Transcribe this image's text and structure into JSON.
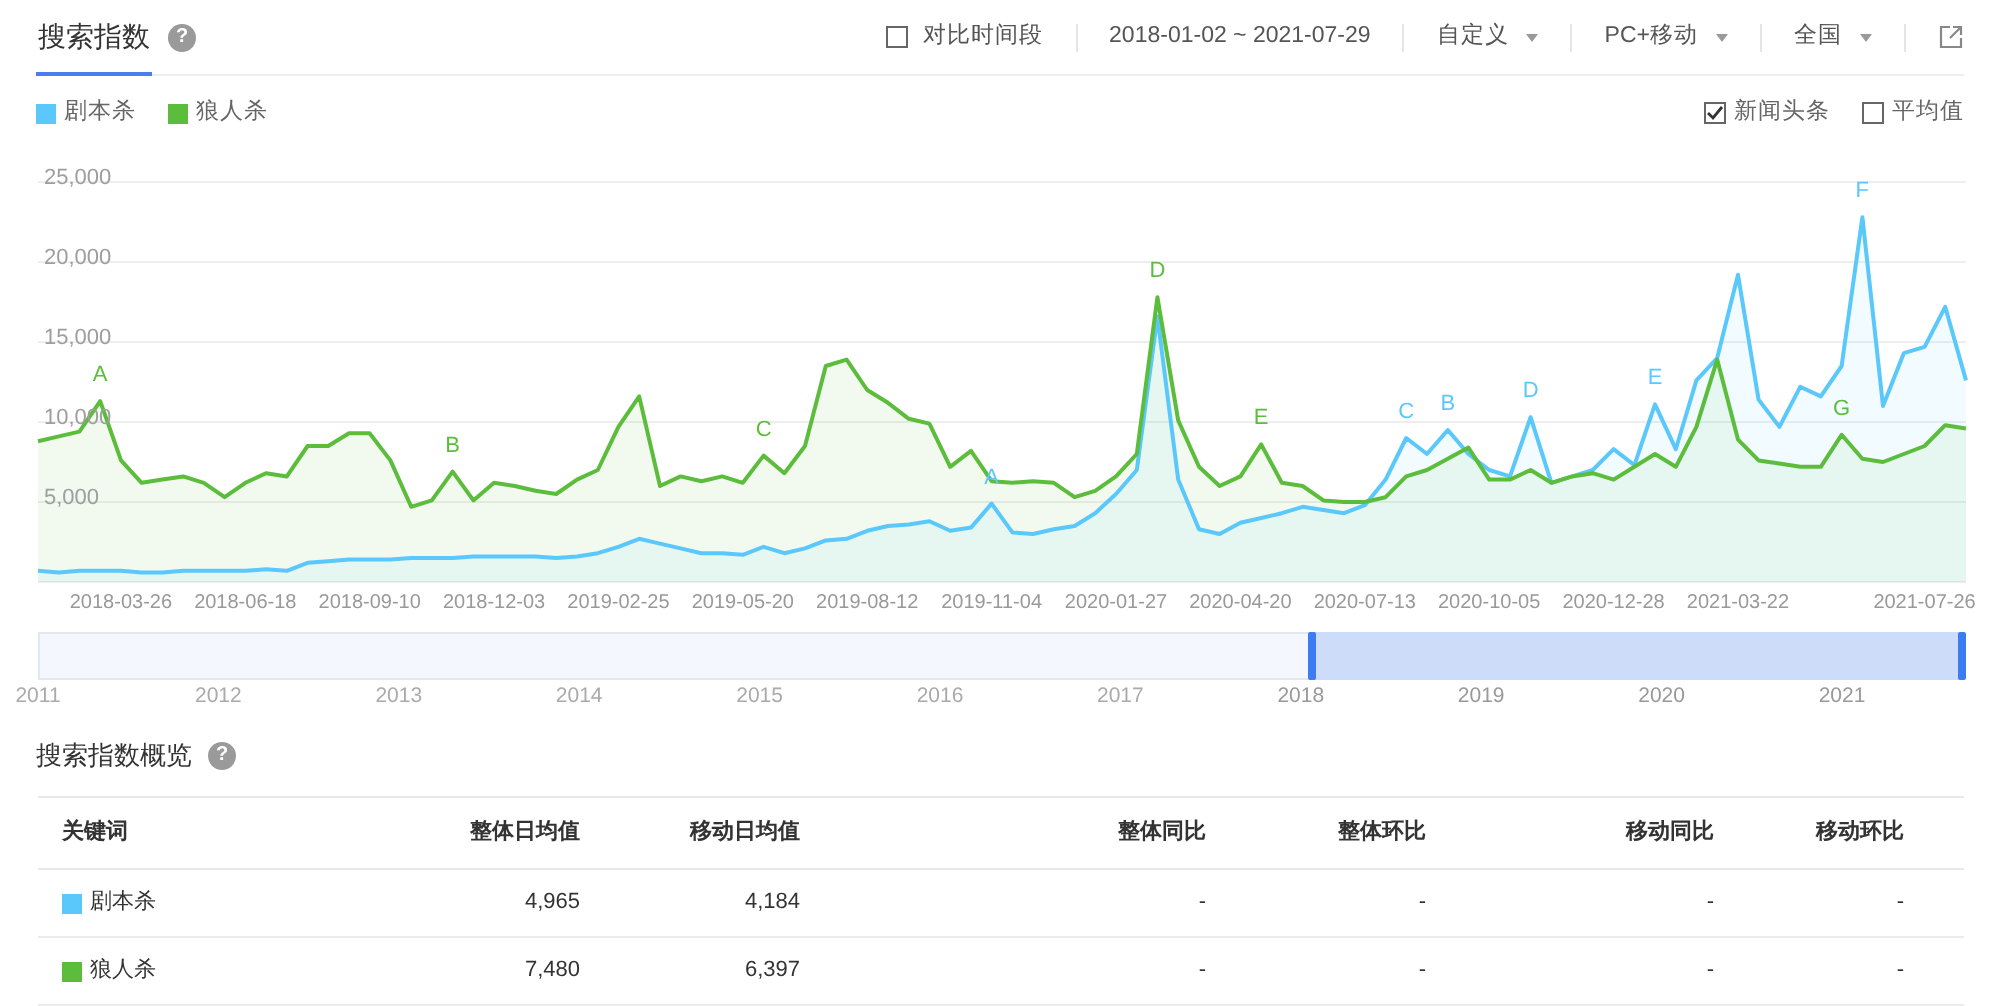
{
  "tabs": [
    {
      "label": "搜索指数",
      "selected": true
    }
  ],
  "help": "?",
  "compare": {
    "label": "对比时间段",
    "checked": false
  },
  "date_range": "2018-01-02 ~ 2021-07-29",
  "dropdowns": [
    {
      "label": "自定义"
    },
    {
      "label": "PC+移动"
    },
    {
      "label": "全国"
    }
  ],
  "options": [
    {
      "label": "新闻头条",
      "checked": true
    },
    {
      "label": "平均值",
      "checked": false
    }
  ],
  "chart_data": {
    "type": "area",
    "grid": true,
    "ylim": [
      0,
      25000
    ],
    "categories": [
      null,
      null,
      null,
      null,
      "2018-03-26",
      null,
      null,
      null,
      null,
      null,
      "2018-06-18",
      null,
      null,
      null,
      null,
      null,
      "2018-09-10",
      null,
      null,
      null,
      null,
      null,
      "2018-12-03",
      null,
      null,
      null,
      null,
      null,
      "2019-02-25",
      null,
      null,
      null,
      null,
      null,
      "2019-05-20",
      null,
      null,
      null,
      null,
      null,
      "2019-08-12",
      null,
      null,
      null,
      null,
      null,
      "2019-11-04",
      null,
      null,
      null,
      null,
      null,
      "2020-01-27",
      null,
      null,
      null,
      null,
      null,
      "2020-04-20",
      null,
      null,
      null,
      null,
      null,
      "2020-07-13",
      null,
      null,
      null,
      null,
      null,
      "2020-10-05",
      null,
      null,
      null,
      null,
      null,
      "2020-12-28",
      null,
      null,
      null,
      null,
      null,
      "2021-03-22",
      null,
      null,
      null,
      null,
      null,
      null,
      null,
      null,
      "2021-07-26",
      null,
      null
    ],
    "series": [
      {
        "name": "剧本杀",
        "color": "#5ac8fa",
        "values": [
          700,
          600,
          700,
          700,
          700,
          600,
          600,
          700,
          700,
          700,
          700,
          800,
          700,
          1200,
          1300,
          1400,
          1400,
          1400,
          1500,
          1500,
          1500,
          1600,
          1600,
          1600,
          1600,
          1500,
          1600,
          1800,
          2200,
          2700,
          2400,
          2100,
          1800,
          1800,
          1700,
          2200,
          1800,
          2100,
          2600,
          2700,
          3200,
          3500,
          3600,
          3800,
          3200,
          3400,
          4900,
          3100,
          3000,
          3300,
          3500,
          4300,
          5500,
          7000,
          16600,
          6400,
          3300,
          3000,
          3700,
          4000,
          4300,
          4700,
          4500,
          4300,
          4800,
          6400,
          9000,
          8000,
          9500,
          8000,
          7000,
          6600,
          10300,
          6200,
          6600,
          7000,
          8300,
          7300,
          11100,
          8300,
          12600,
          14000,
          19200,
          11400,
          9700,
          12200,
          11600,
          13500,
          22800,
          11000,
          14300,
          14700,
          17200,
          12600
        ]
      },
      {
        "name": "狼人杀",
        "color": "#5cbd3c",
        "values": [
          8800,
          9100,
          9400,
          11300,
          7600,
          6200,
          6400,
          6600,
          6200,
          5300,
          6200,
          6800,
          6600,
          8500,
          8500,
          9300,
          9300,
          7600,
          4700,
          5100,
          6900,
          5100,
          6200,
          6000,
          5700,
          5500,
          6400,
          7000,
          9700,
          11600,
          6000,
          6600,
          6300,
          6600,
          6200,
          7900,
          6800,
          8500,
          13500,
          13900,
          12000,
          11200,
          10200,
          9900,
          7200,
          8200,
          6300,
          6200,
          6300,
          6200,
          5300,
          5700,
          6600,
          8000,
          17800,
          10100,
          7200,
          6000,
          6600,
          8600,
          6200,
          6000,
          5100,
          5000,
          5000,
          5300,
          6600,
          7000,
          7700,
          8400,
          6400,
          6400,
          7000,
          6200,
          6600,
          6800,
          6400,
          7200,
          8000,
          7200,
          9700,
          13900,
          8900,
          7600,
          7400,
          7200,
          7200,
          9200,
          7700,
          7500,
          8000,
          8500,
          9800,
          9600
        ]
      }
    ],
    "yticks": [
      {
        "value": 5000,
        "label": "5,000"
      },
      {
        "value": 10000,
        "label": "10,000"
      },
      {
        "value": 15000,
        "label": "15,000"
      },
      {
        "value": 20000,
        "label": "20,000"
      },
      {
        "value": 25000,
        "label": "25,000"
      }
    ],
    "annotations": [
      {
        "y": 11300,
        "text": "A"
      },
      {
        "y": 6900,
        "text": "B"
      },
      {
        "y": 7900,
        "text": "C"
      },
      {
        "y": 17800,
        "text": "D"
      },
      {
        "y": 8600,
        "text": "E"
      },
      {
        "y": 9200,
        "text": "G"
      },
      {
        "y": 4900,
        "text": "A"
      },
      {
        "y": 9000,
        "text": "C"
      },
      {
        "y": 9500,
        "text": "B"
      },
      {
        "y": 10300,
        "text": "D"
      },
      {
        "y": 11100,
        "text": "E"
      },
      {
        "y": 22800,
        "text": "F"
      }
    ]
  },
  "navigator": {
    "years": [
      {
        "label": "2011",
        "selected": false
      },
      {
        "label": "2012",
        "selected": false
      },
      {
        "label": "2013",
        "selected": false
      },
      {
        "label": "2014",
        "selected": false
      },
      {
        "label": "2015",
        "selected": false
      },
      {
        "label": "2016",
        "selected": false
      },
      {
        "label": "2017",
        "selected": false
      },
      {
        "label": "2018",
        "selected": true
      },
      {
        "label": "2019",
        "selected": true
      },
      {
        "label": "2020",
        "selected": true
      },
      {
        "label": "2021",
        "selected": true
      }
    ]
  },
  "overview": {
    "title": "搜索指数概览",
    "help": "?",
    "columns": [
      "关键词",
      "整体日均值",
      "移动日均值",
      "整体同比",
      "整体环比",
      "移动同比",
      "移动环比"
    ],
    "rows": [
      {
        "color": "#5ac8fa",
        "cells": [
          "剧本杀",
          "4,965",
          "4,184",
          "-",
          "-",
          "-",
          "-"
        ]
      },
      {
        "color": "#5cbd3c",
        "cells": [
          "狼人杀",
          "7,480",
          "6,397",
          "-",
          "-",
          "-",
          "-"
        ]
      }
    ]
  }
}
